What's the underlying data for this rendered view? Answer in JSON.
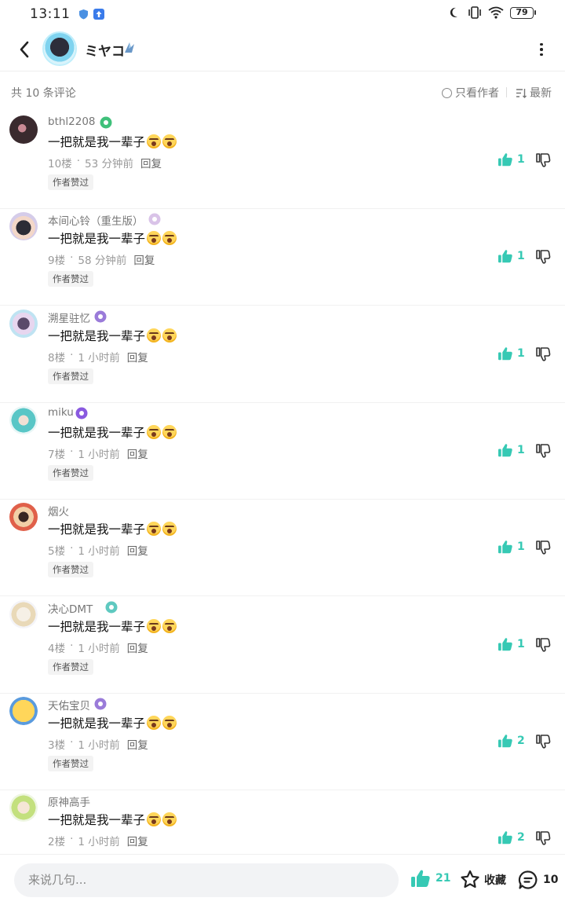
{
  "status_bar": {
    "time": "13:11",
    "battery": "79"
  },
  "header": {
    "name": "ミヤコ"
  },
  "toolbar": {
    "count_label": "共 10 条评论",
    "author_only_label": "只看作者",
    "sort_label": "最新"
  },
  "comments": [
    {
      "username": "bthl2208",
      "text": "一把就是我一辈子",
      "floor": "10楼",
      "time": "53 分钟前",
      "reply": "回复",
      "tag": "作者赞过",
      "likes": "1",
      "badge": "home-badge-icon",
      "badge_color": "#3fc07a"
    },
    {
      "username": "本间心铃（重生版）",
      "text": "一把就是我一辈子",
      "floor": "9楼",
      "time": "58 分钟前",
      "reply": "回复",
      "tag": "作者赞过",
      "likes": "1",
      "badge": "character-badge-icon",
      "badge_color": "#d9c3e8"
    },
    {
      "username": "溯星驻忆",
      "text": "一把就是我一辈子",
      "floor": "8楼",
      "time": "1 小时前",
      "reply": "回复",
      "tag": "作者赞过",
      "likes": "1",
      "badge": "butterfly-badge-icon",
      "badge_color": "#9a7bd9"
    },
    {
      "username": "miku",
      "text": "一把就是我一辈子",
      "floor": "7楼",
      "time": "1 小时前",
      "reply": "回复",
      "tag": "作者赞过",
      "likes": "1",
      "badge": "trophy-badge-icon",
      "badge_color": "#8a5ae0"
    },
    {
      "username": "烟火",
      "text": "一把就是我一辈子",
      "floor": "5楼",
      "time": "1 小时前",
      "reply": "回复",
      "tag": "作者赞过",
      "likes": "1",
      "badge": "",
      "badge_color": ""
    },
    {
      "username": "决心DMT",
      "text": "一把就是我一辈子",
      "floor": "4楼",
      "time": "1 小时前",
      "reply": "回复",
      "tag": "作者赞过",
      "likes": "1",
      "badge": "level-badge-icon",
      "badge_color": "#5fc9c0"
    },
    {
      "username": "天佑宝贝",
      "text": "一把就是我一辈子",
      "floor": "3楼",
      "time": "1 小时前",
      "reply": "回复",
      "tag": "作者赞过",
      "likes": "2",
      "badge": "butterfly-badge-icon",
      "badge_color": "#9a7bd9"
    },
    {
      "username": "原神高手",
      "text": "一把就是我一辈子",
      "floor": "2楼",
      "time": "1 小时前",
      "reply": "回复",
      "tag": "",
      "likes": "2",
      "badge": "",
      "badge_color": ""
    }
  ],
  "bottom_bar": {
    "input_placeholder": "来说几句...",
    "like_count": "21",
    "favorite_label": "收藏",
    "comment_count": "10"
  },
  "colors": {
    "accent": "#36c9b4",
    "text_muted": "#9a9a9a"
  }
}
